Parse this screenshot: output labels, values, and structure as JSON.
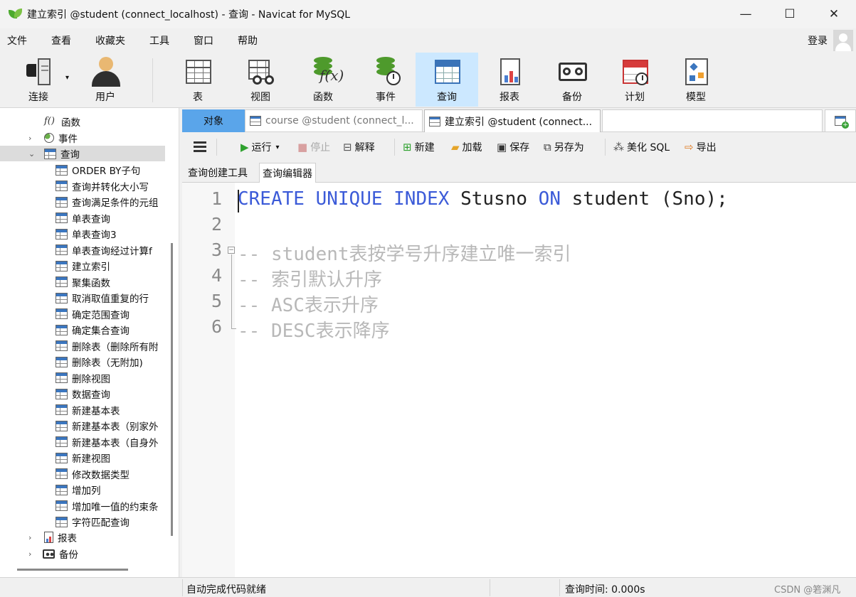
{
  "window": {
    "title": "建立索引 @student (connect_localhost) - 查询 - Navicat for MySQL",
    "minimize": "—",
    "maximize": "☐",
    "close": "✕"
  },
  "menu": [
    "文件",
    "查看",
    "收藏夹",
    "工具",
    "窗口",
    "帮助"
  ],
  "login_label": "登录",
  "toolbar": {
    "connect": "连接",
    "user": "用户",
    "table": "表",
    "view": "视图",
    "function": "函数",
    "event": "事件",
    "query": "查询",
    "report": "报表",
    "backup": "备份",
    "schedule": "计划",
    "model": "模型"
  },
  "sidebar": {
    "function_label": "函数",
    "event_label": "事件",
    "query_label": "查询",
    "queries": [
      "ORDER BY子句",
      "查询并转化大小写",
      "查询满足条件的元组",
      "单表查询",
      "单表查询3",
      "单表查询经过计算f",
      "建立索引",
      "聚集函数",
      "取消取值重复的行",
      "确定范围查询",
      "确定集合查询",
      "删除表（删除所有附",
      "删除表（无附加)",
      "删除视图",
      "数据查询",
      "新建基本表",
      "新建基本表（别家外",
      "新建基本表（自身外",
      "新建视图",
      "修改数据类型",
      "增加列",
      "增加唯一值的约束条",
      "字符匹配查询"
    ],
    "report_label": "报表",
    "backup_label": "备份"
  },
  "tabs": {
    "objects": "对象",
    "course": "course @student (connect_l...",
    "index": "建立索引 @student (connect..."
  },
  "query_toolbar": {
    "run": "运行",
    "stop": "停止",
    "explain": "解释",
    "new": "新建",
    "load": "加载",
    "save": "保存",
    "save_as": "另存为",
    "beautify": "美化 SQL",
    "export": "导出"
  },
  "subtabs": {
    "builder": "查询创建工具",
    "editor": "查询编辑器"
  },
  "editor": {
    "line_numbers": [
      "1",
      "2",
      "3",
      "4",
      "5",
      "6"
    ],
    "line1": {
      "kw1": "CREATE",
      "kw2": "UNIQUE",
      "kw3": "INDEX",
      "name": "Stusno",
      "kw4": "ON",
      "rest": "student (Sno);"
    },
    "comments": [
      "-- student表按学号升序建立唯一索引",
      "-- 索引默认升序",
      "-- ASC表示升序",
      "-- DESC表示降序"
    ]
  },
  "status": {
    "autocomplete": "自动完成代码就绪",
    "query_time": "查询时间: 0.000s",
    "watermark": "CSDN @箬渊凡"
  },
  "colors": {
    "keyword": "#3c5bd8",
    "comment": "#b8b8b8",
    "active_tab": "#5aa5ea",
    "toolbar_active": "#cce8ff"
  }
}
